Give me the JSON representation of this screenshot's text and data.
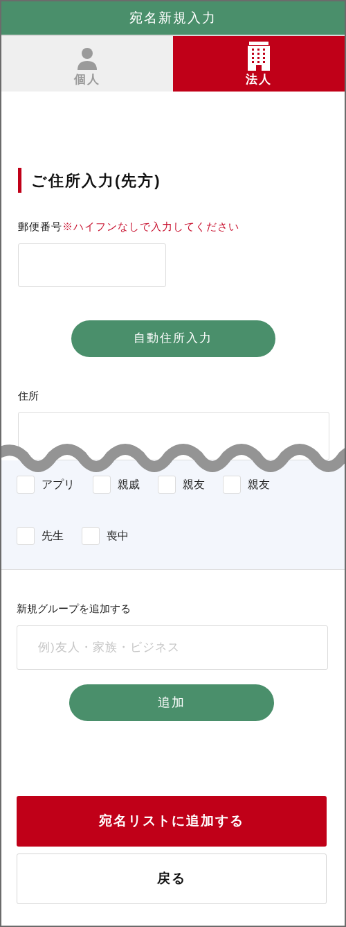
{
  "header": {
    "title": "宛名新規入力"
  },
  "tabs": [
    {
      "label": "個人",
      "kind": "person",
      "selected": false
    },
    {
      "label": "法人",
      "kind": "building",
      "selected": true
    }
  ],
  "address_section": {
    "heading": "ご住所入力(先方)",
    "postal_label": "郵便番号",
    "postal_note": "※ハイフンなしで入力してください",
    "auto_button": "自動住所入力",
    "address_label": "住所"
  },
  "groups": [
    {
      "label": "アプリ",
      "checked": false
    },
    {
      "label": "親戚",
      "checked": false
    },
    {
      "label": "親友",
      "checked": false
    },
    {
      "label": "親友",
      "checked": false
    },
    {
      "label": "先生",
      "checked": false
    },
    {
      "label": "喪中",
      "checked": false
    }
  ],
  "new_group": {
    "label": "新規グループを追加する",
    "placeholder": "例)友人・家族・ビジネス",
    "button": "追加"
  },
  "actions": {
    "primary": "宛名リストに追加する",
    "secondary": "戻る"
  }
}
